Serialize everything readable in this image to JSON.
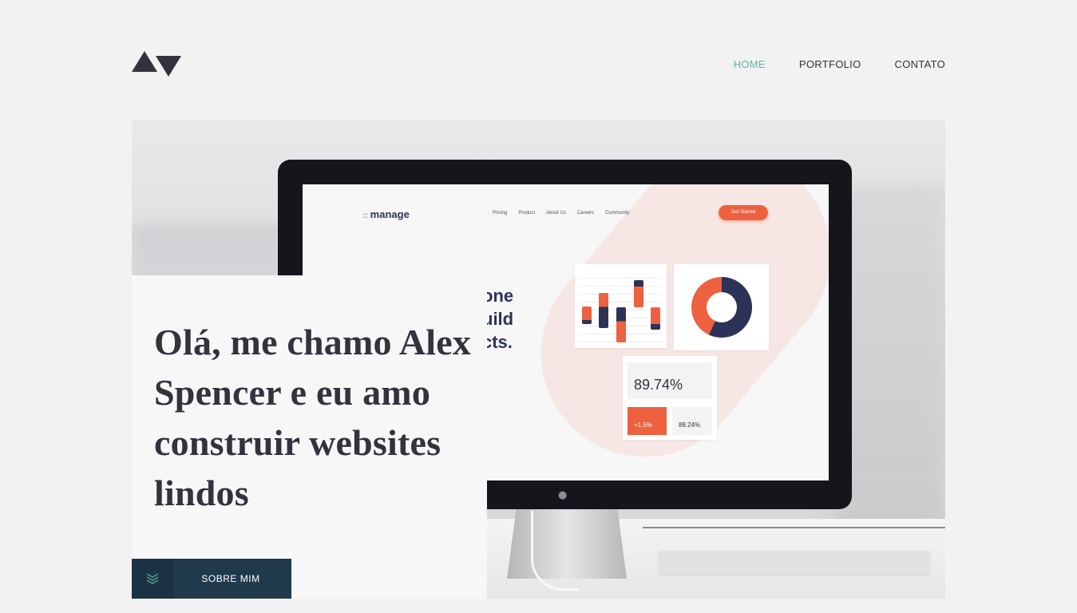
{
  "header": {
    "logo": "logo-icon",
    "nav": [
      {
        "label": "HOME",
        "active": true
      },
      {
        "label": "PORTFOLIO",
        "active": false
      },
      {
        "label": "CONTATO",
        "active": false
      }
    ]
  },
  "hero": {
    "screen": {
      "brand": "manage",
      "nav": [
        "Pricing",
        "Product",
        "About Us",
        "Careers",
        "Community"
      ],
      "cta": "Get Started",
      "headline_lines": [
        "one",
        "uild",
        "cts."
      ],
      "stat_main": "89.74%",
      "stat_change": "+1.5%",
      "stat_secondary": "88.24%"
    },
    "intro": {
      "heading": "Olá, me chamo Alex Spencer e eu amo construir websites lindos"
    },
    "about_button": {
      "label": "SOBRE MIM",
      "icon": "chevrons-down-icon"
    }
  },
  "colors": {
    "background": "#f2f2f2",
    "text": "#33323d",
    "accent": "#5fb4a2",
    "button": "#203a4c",
    "orange": "#ed6140",
    "navy": "#2d3356"
  }
}
